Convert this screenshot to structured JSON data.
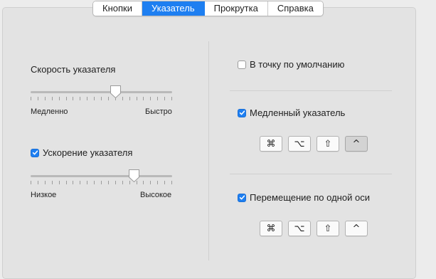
{
  "tabs": [
    {
      "label": "Кнопки",
      "active": false
    },
    {
      "label": "Указатель",
      "active": true
    },
    {
      "label": "Прокрутка",
      "active": false
    },
    {
      "label": "Справка",
      "active": false
    }
  ],
  "pointer_speed": {
    "title": "Скорость указателя",
    "min_label": "Медленно",
    "max_label": "Быстро",
    "value": 0.6,
    "ticks": 21
  },
  "acceleration": {
    "label": "Ускорение указателя",
    "checked": true,
    "min_label": "Низкое",
    "max_label": "Высокое",
    "value": 0.73,
    "ticks": 21
  },
  "default_point": {
    "label": "В точку по умолчанию",
    "checked": false
  },
  "slow_pointer": {
    "label": "Медленный указатель",
    "checked": true,
    "keys": [
      {
        "symbol": "⌘",
        "icon": "command-key-icon",
        "pressed": false
      },
      {
        "symbol": "⌥",
        "icon": "option-key-icon",
        "pressed": false
      },
      {
        "symbol": "⇧",
        "icon": "shift-key-icon",
        "pressed": false
      },
      {
        "symbol": "^",
        "icon": "control-key-icon",
        "pressed": true
      }
    ]
  },
  "single_axis": {
    "label": "Перемещение по одной оси",
    "checked": true,
    "keys": [
      {
        "symbol": "⌘",
        "icon": "command-key-icon",
        "pressed": false
      },
      {
        "symbol": "⌥",
        "icon": "option-key-icon",
        "pressed": false
      },
      {
        "symbol": "⇧",
        "icon": "shift-key-icon",
        "pressed": false
      },
      {
        "symbol": "^",
        "icon": "control-key-icon",
        "pressed": false
      }
    ]
  },
  "colors": {
    "accent": "#1e7ff1"
  }
}
